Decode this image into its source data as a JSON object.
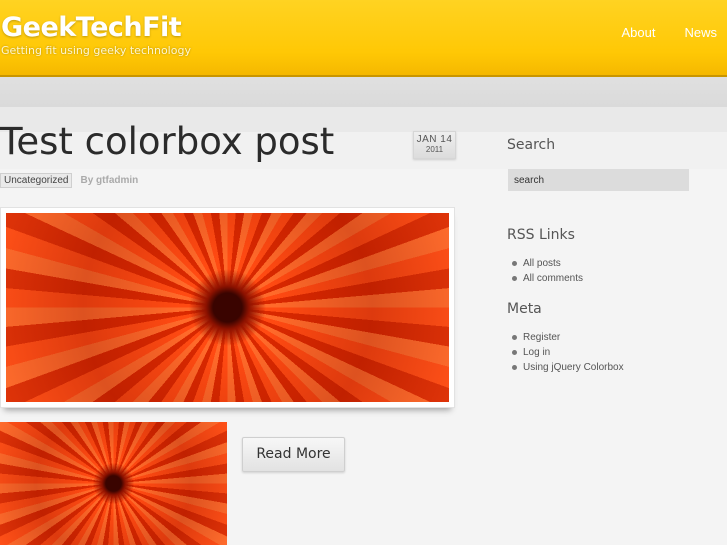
{
  "site": {
    "title": "GeekTechFit",
    "tagline": "Getting fit using geeky technology"
  },
  "nav": [
    {
      "label": "About"
    },
    {
      "label": "News"
    }
  ],
  "post": {
    "title": "Test colorbox post",
    "date_month_day": "JAN 14",
    "date_year": "2011",
    "category": "Uncategorized",
    "author": "By gtfadmin",
    "read_more_label": "Read More"
  },
  "sidebar": {
    "search_heading": "Search",
    "search_value": "search",
    "rss_heading": "RSS Links",
    "rss_items": [
      {
        "label": "All posts"
      },
      {
        "label": "All comments"
      }
    ],
    "meta_heading": "Meta",
    "meta_items": [
      {
        "label": "Register"
      },
      {
        "label": "Log in"
      },
      {
        "label": "Using jQuery Colorbox"
      }
    ]
  },
  "colors": {
    "header": "#ffc805",
    "background": "#f4f4f4",
    "flower": "#e8350a"
  }
}
